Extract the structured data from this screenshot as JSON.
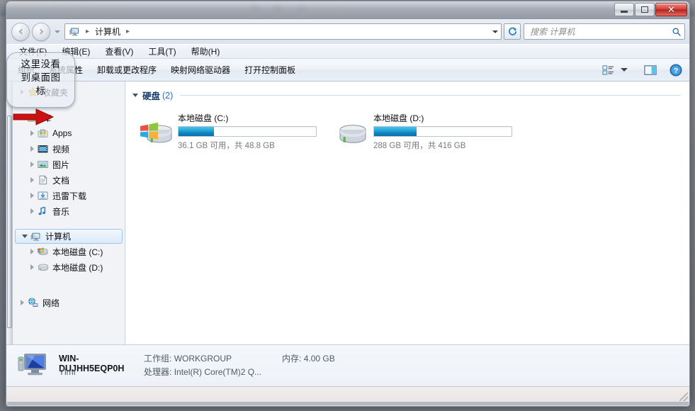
{
  "window": {
    "caption_buttons": {
      "minimize": "minimize-icon",
      "maximize": "restore-icon",
      "close": "✕"
    }
  },
  "navbar": {
    "back": "back-arrow-icon",
    "forward": "forward-arrow-icon",
    "history_dropdown": "chevron-down-icon",
    "breadcrumb": {
      "root_icon": "computer-icon",
      "items": [
        "计算机"
      ],
      "separator": "▸"
    },
    "address_dropdown": "chevron-down-icon",
    "refresh": "refresh-icon",
    "search": {
      "placeholder": "搜索 计算机",
      "icon": "search-icon"
    }
  },
  "menubar": {
    "items": [
      {
        "label": "文件(F)"
      },
      {
        "label": "编辑(E)"
      },
      {
        "label": "查看(V)"
      },
      {
        "label": "工具(T)"
      },
      {
        "label": "帮助(H)"
      }
    ]
  },
  "toolbar": {
    "items": [
      {
        "label": "组织"
      },
      {
        "label": "系统属性"
      },
      {
        "label": "卸载或更改程序"
      },
      {
        "label": "映射网络驱动器"
      },
      {
        "label": "打开控制面板"
      }
    ],
    "right_icons": [
      {
        "name": "change-view-icon"
      },
      {
        "name": "chevron-down-icon"
      },
      {
        "name": "preview-pane-icon"
      },
      {
        "name": "help-icon"
      }
    ]
  },
  "navpane": {
    "items": [
      {
        "label": "收藏夹",
        "icon": "star-icon",
        "level": 1,
        "expander": "closed",
        "obscured": true
      },
      {
        "label": "库",
        "icon": "library-icon",
        "level": 1,
        "expander": "open"
      },
      {
        "label": "Apps",
        "icon": "apps-icon",
        "level": 2,
        "expander": "closed"
      },
      {
        "label": "视频",
        "icon": "video-icon",
        "level": 2,
        "expander": "closed"
      },
      {
        "label": "图片",
        "icon": "pictures-icon",
        "level": 2,
        "expander": "closed"
      },
      {
        "label": "文档",
        "icon": "documents-icon",
        "level": 2,
        "expander": "closed"
      },
      {
        "label": "迅雷下载",
        "icon": "downloads-icon",
        "level": 2,
        "expander": "closed"
      },
      {
        "label": "音乐",
        "icon": "music-icon",
        "level": 2,
        "expander": "closed"
      },
      {
        "label": "计算机",
        "icon": "computer-icon",
        "level": 1,
        "expander": "open",
        "selected": true
      },
      {
        "label": "本地磁盘 (C:)",
        "icon": "drive-windows-icon",
        "level": 2,
        "expander": "closed"
      },
      {
        "label": "本地磁盘 (D:)",
        "icon": "drive-icon",
        "level": 2,
        "expander": "closed"
      },
      {
        "label": "网络",
        "icon": "network-icon",
        "level": 1,
        "expander": "closed"
      }
    ]
  },
  "content": {
    "group": {
      "title": "硬盘",
      "count": "(2)",
      "expander": "open"
    },
    "drives": [
      {
        "name": "本地磁盘 (C:)",
        "icon": "drive-windows-icon",
        "free": "36.1 GB",
        "total": "48.8 GB",
        "capacity_text": "36.1 GB 可用，共 48.8 GB",
        "used_percent": 26
      },
      {
        "name": "本地磁盘 (D:)",
        "icon": "drive-icon",
        "free": "288 GB",
        "total": "416 GB",
        "capacity_text": "288 GB 可用，共 416 GB",
        "used_percent": 31
      }
    ]
  },
  "details": {
    "icon": "computer-icon",
    "computer_name": "WIN-DUJHH5EQP0H",
    "user_name": "Ylmf",
    "workgroup_label": "工作组:",
    "workgroup_value": "WORKGROUP",
    "processor_label": "处理器:",
    "processor_value": "Intel(R) Core(TM)2 Q...",
    "memory_label": "内存:",
    "memory_value": "4.00 GB"
  },
  "annotation": {
    "callout_text": "这里没看\n到桌面图\n标",
    "arrow_color": "#cc1111"
  },
  "colors": {
    "accent_blue": "#1187c4",
    "close_red": "#c2332a",
    "group_title": "#1b3f6e",
    "selection_blue": "#9cc6ee"
  }
}
